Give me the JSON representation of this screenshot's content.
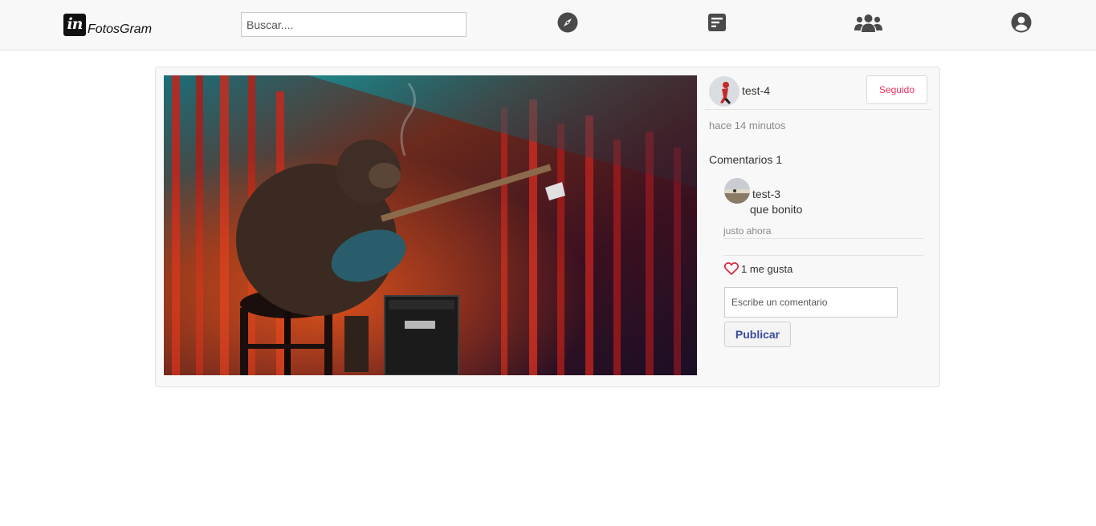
{
  "app": {
    "logo_text": "FotosGram",
    "logo_mark": "in"
  },
  "search": {
    "placeholder": "Buscar...."
  },
  "nav": {
    "icons": [
      "compass-icon",
      "posts-icon",
      "users-icon",
      "user-circle-icon"
    ]
  },
  "post": {
    "owner": "test-4",
    "follow_label": "Seguido",
    "time_ago": "hace 14 minutos",
    "comments_title": "Comentarios 1",
    "comments": [
      {
        "user": "test-3",
        "text": "que bonito",
        "time": "justo ahora"
      }
    ],
    "likes_label": "1 me gusta",
    "comment_placeholder": "Escribe un comentario",
    "publish_label": "Publicar"
  },
  "colors": {
    "accent_pink": "#e8305f",
    "button_blue": "#3a4a9f",
    "heart_red": "#d9263f",
    "icon_gray": "#4a4a4a"
  }
}
